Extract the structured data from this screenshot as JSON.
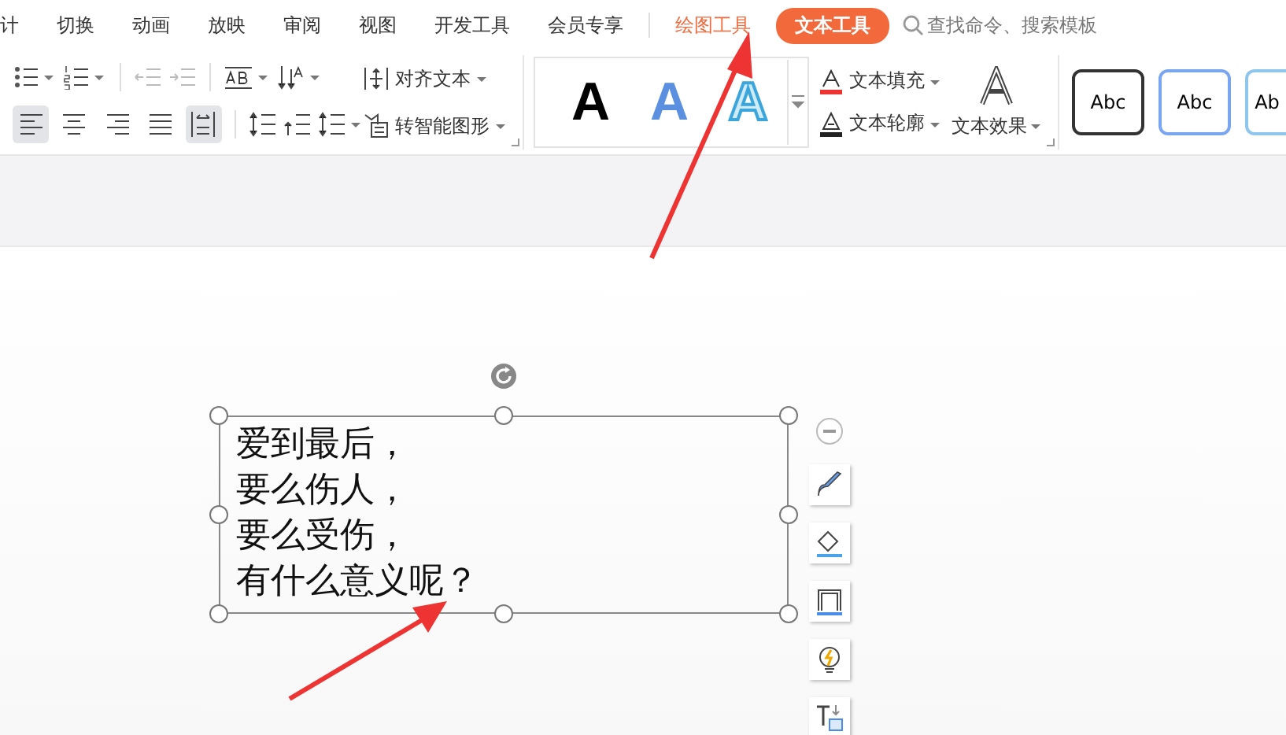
{
  "menu_tabs": [
    {
      "label": "计",
      "kind": "plain",
      "selected": false
    },
    {
      "label": "切换",
      "kind": "plain",
      "selected": false
    },
    {
      "label": "动画",
      "kind": "plain",
      "selected": false
    },
    {
      "label": "放映",
      "kind": "plain",
      "selected": false
    },
    {
      "label": "审阅",
      "kind": "plain",
      "selected": false
    },
    {
      "label": "视图",
      "kind": "plain",
      "selected": false
    },
    {
      "label": "开发工具",
      "kind": "plain",
      "selected": false
    },
    {
      "label": "会员专享",
      "kind": "plain",
      "selected": false
    },
    {
      "label": "绘图工具",
      "kind": "contextual",
      "selected": false
    },
    {
      "label": "文本工具",
      "kind": "contextual",
      "selected": true
    }
  ],
  "search": {
    "placeholder": "查找命令、搜索模板"
  },
  "ribbon": {
    "align_buttons": [
      {
        "kind": "left",
        "selected": true
      },
      {
        "kind": "center",
        "selected": false
      },
      {
        "kind": "right",
        "selected": false
      },
      {
        "kind": "justify",
        "selected": false
      },
      {
        "kind": "distributed",
        "selected": true
      }
    ],
    "align_text": "对齐文本",
    "smart_shape": "转智能图形",
    "text_styles": [
      {
        "label": "A",
        "kind": "black"
      },
      {
        "label": "A",
        "kind": "blue"
      },
      {
        "label": "A",
        "kind": "outline"
      }
    ],
    "text_fill": "文本填充",
    "text_outline": "文本轮廓",
    "text_effect": "文本效果",
    "shape_styles": [
      {
        "label": "Abc",
        "kind": "dark"
      },
      {
        "label": "Abc",
        "kind": "blue"
      },
      {
        "label": "Ab",
        "kind": "light"
      }
    ]
  },
  "text_box": {
    "lines": [
      "爱到最后，",
      "要么伤人，",
      "要么受伤，",
      "有什么意义呢？"
    ]
  }
}
